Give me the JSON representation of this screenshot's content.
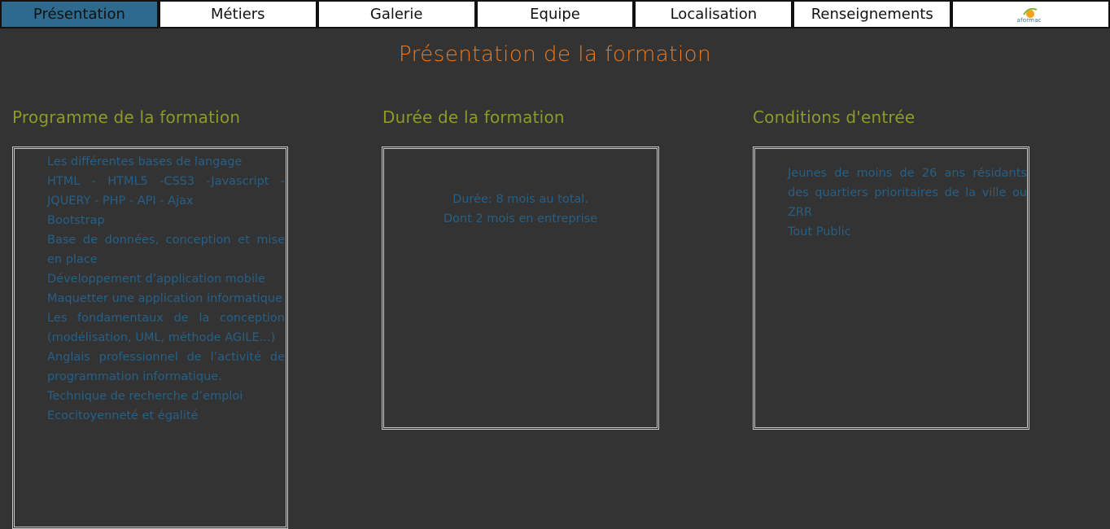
{
  "nav": {
    "items": [
      {
        "label": "Présentation",
        "active": true
      },
      {
        "label": "Métiers",
        "active": false
      },
      {
        "label": "Galerie",
        "active": false
      },
      {
        "label": "Equipe",
        "active": false
      },
      {
        "label": "Localisation",
        "active": false
      },
      {
        "label": "Renseignements",
        "active": false
      }
    ],
    "logo": {
      "icon": "aformac-logo",
      "text": "aformac"
    }
  },
  "page": {
    "title": "Présentation de la formation"
  },
  "sections": {
    "programme": {
      "heading": "Programme de la formation",
      "items": [
        "Les différentes bases de langage",
        "HTML - HTML5 -CSS3 -Javascript - JQUERY - PHP - API - Ajax",
        "Bootstrap",
        "Base de données, conception et mise en place",
        "Développement d’application mobile",
        "Maquetter une application informatique",
        "Les fondamentaux de la conception (modélisation, UML, méthode AGILE...)",
        "Anglais professionnel de l’activité de programmation informatique.",
        "Technique de recherche d’emploi",
        "Ecocitoyenneté et égalité"
      ]
    },
    "duree": {
      "heading": "Durée de la formation",
      "line1": "Durée: 8 mois au total.",
      "line2": "Dont 2 mois en entreprise"
    },
    "conditions": {
      "heading": "Conditions d'entrée",
      "items": [
        "Jeunes de moins de 26 ans résidants des quartiers prioritaires de la ville ou ZRR",
        "Tout Public"
      ]
    }
  },
  "colors": {
    "background": "#333333",
    "nav_active": "#2e6a8e",
    "title": "#f07a1c",
    "heading": "#8c9a2a",
    "body_text": "#275f86"
  }
}
